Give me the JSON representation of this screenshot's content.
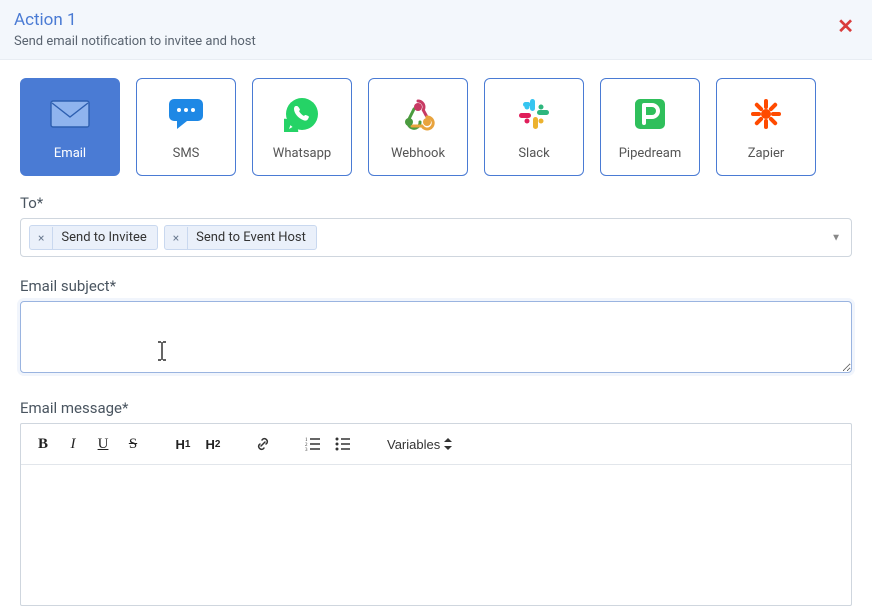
{
  "header": {
    "title": "Action 1",
    "subtitle": "Send email notification to invitee and host"
  },
  "channels": [
    {
      "id": "email",
      "label": "Email",
      "active": true
    },
    {
      "id": "sms",
      "label": "SMS",
      "active": false
    },
    {
      "id": "whatsapp",
      "label": "Whatsapp",
      "active": false
    },
    {
      "id": "webhook",
      "label": "Webhook",
      "active": false
    },
    {
      "id": "slack",
      "label": "Slack",
      "active": false
    },
    {
      "id": "pipedream",
      "label": "Pipedream",
      "active": false
    },
    {
      "id": "zapier",
      "label": "Zapier",
      "active": false
    }
  ],
  "fields": {
    "to_label": "To*",
    "to_chips": [
      {
        "label": "Send to Invitee"
      },
      {
        "label": "Send to Event Host"
      }
    ],
    "subject_label": "Email subject*",
    "subject_value": "",
    "message_label": "Email message*"
  },
  "toolbar": {
    "variables_label": "Variables"
  }
}
